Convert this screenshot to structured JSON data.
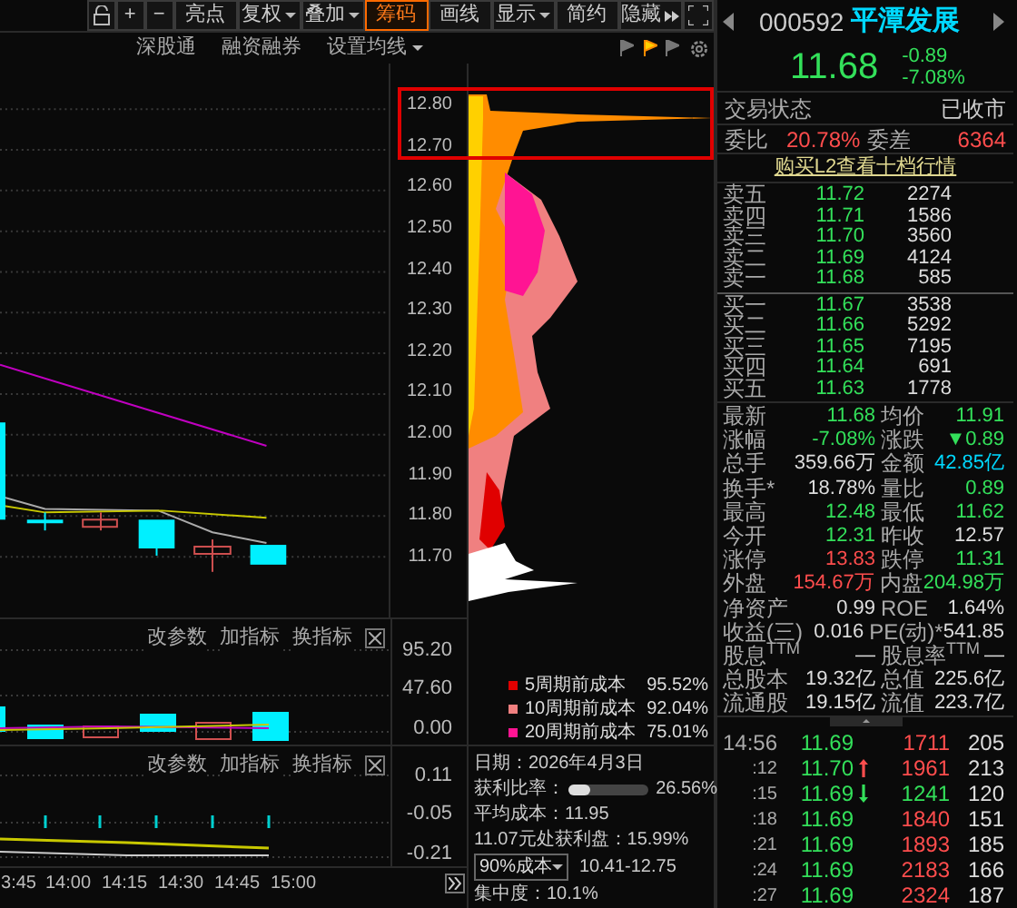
{
  "toolbar": {
    "buttons": [
      {
        "label": "+",
        "dropdown": false,
        "selected": false
      },
      {
        "label": "−",
        "dropdown": false,
        "selected": false
      },
      {
        "label": "亮点",
        "dropdown": false,
        "selected": false
      },
      {
        "label": "复权",
        "dropdown": true,
        "selected": false
      },
      {
        "label": "叠加",
        "dropdown": true,
        "selected": false
      },
      {
        "label": "筹码",
        "dropdown": false,
        "selected": true
      },
      {
        "label": "画线",
        "dropdown": false,
        "selected": false
      },
      {
        "label": "显示",
        "dropdown": true,
        "selected": false
      },
      {
        "label": "简约",
        "dropdown": false,
        "selected": false
      },
      {
        "label": "隐藏",
        "dropdown": false,
        "selected": false,
        "arrows": true
      }
    ]
  },
  "chart_toolbar": [
    {
      "label": "深股通",
      "dropdown": false
    },
    {
      "label": "融资融券",
      "dropdown": false
    },
    {
      "label": "设置均线",
      "dropdown": true
    }
  ],
  "main_chart": {
    "y_labels": [
      "12.80",
      "12.70",
      "12.60",
      "12.50",
      "12.40",
      "12.30",
      "12.20",
      "12.10",
      "12.00",
      "11.90",
      "11.80",
      "11.70"
    ]
  },
  "indicator_panes": [
    {
      "tools": [
        "改参数",
        "加指标",
        "换指标"
      ],
      "y_labels": [
        "95.20",
        "47.60",
        "0.00"
      ]
    },
    {
      "tools": [
        "改参数",
        "加指标",
        "换指标"
      ],
      "y_labels": [
        "0.11",
        "-0.05",
        "-0.21"
      ]
    }
  ],
  "time_axis": [
    "3:45",
    "14:00",
    "14:15",
    "14:30",
    "14:45",
    "15:00"
  ],
  "chip_panel": {
    "legend": [
      {
        "label": "5周期前成本",
        "value": "95.52%",
        "color": "#e00000"
      },
      {
        "label": "10周期前成本",
        "value": "92.04%",
        "color": "#f08080"
      },
      {
        "label": "20周期前成本",
        "value": "75.01%",
        "color": "#ff1493"
      }
    ],
    "date": "日期：2026年4月3日",
    "profit_label": "获利比率：",
    "profit_ratio": {
      "level": 0.2656,
      "reading": "26.56%"
    },
    "avg_cost": "平均成本：11.95",
    "profit_at": "11.07元处获利盘：15.99%",
    "cost_range": {
      "option": "90%成本",
      "value": "10.41-12.75"
    },
    "concentration": "集中度：10.1%"
  },
  "quote": {
    "code": "000592",
    "name": "平潭发展",
    "price": "11.68",
    "change": "-0.89",
    "percent": "-7.08%",
    "status_label": "交易状态",
    "status": "已收市",
    "ratio_label": "委比",
    "ratio": "20.78%",
    "diff_label": "委差",
    "diff": "6364",
    "l2_link": "购买L2查看十档行情",
    "asks": [
      {
        "label": "卖五",
        "price": "11.72",
        "volume": "2274"
      },
      {
        "label": "卖四",
        "price": "11.71",
        "volume": "1586"
      },
      {
        "label": "卖三",
        "price": "11.70",
        "volume": "3560"
      },
      {
        "label": "卖二",
        "price": "11.69",
        "volume": "4124"
      },
      {
        "label": "卖一",
        "price": "11.68",
        "volume": "585"
      }
    ],
    "bids": [
      {
        "label": "买一",
        "price": "11.67",
        "volume": "3538"
      },
      {
        "label": "买二",
        "price": "11.66",
        "volume": "5292"
      },
      {
        "label": "买三",
        "price": "11.65",
        "volume": "7195"
      },
      {
        "label": "买四",
        "price": "11.64",
        "volume": "691"
      },
      {
        "label": "买五",
        "price": "11.63",
        "volume": "1778"
      }
    ],
    "stats": [
      [
        {
          "label": "最新",
          "value": "11.68",
          "color": "#33e05a"
        },
        {
          "label": "均价",
          "value": "11.91",
          "color": "#33e05a"
        }
      ],
      [
        {
          "label": "涨幅",
          "value": "-7.08%",
          "color": "#33e05a"
        },
        {
          "label": "涨跌",
          "value": "▼0.89",
          "color": "#33e05a"
        }
      ],
      [
        {
          "label": "总手",
          "value": "359.66万",
          "color": "#dddddd"
        },
        {
          "label": "金额",
          "value": "42.85亿",
          "color": "#00d8ff"
        }
      ],
      [
        {
          "label": "换手*",
          "value": "18.78%",
          "color": "#dddddd"
        },
        {
          "label": "量比",
          "value": "0.89",
          "color": "#33e05a"
        }
      ],
      [
        {
          "label": "最高",
          "value": "12.48",
          "color": "#33e05a"
        },
        {
          "label": "最低",
          "value": "11.62",
          "color": "#33e05a"
        }
      ],
      [
        {
          "label": "今开",
          "value": "12.31",
          "color": "#33e05a"
        },
        {
          "label": "昨收",
          "value": "12.57",
          "color": "#dddddd"
        }
      ],
      [
        {
          "label": "涨停",
          "value": "13.83",
          "color": "#ff4d4d"
        },
        {
          "label": "跌停",
          "value": "11.31",
          "color": "#33e05a"
        }
      ],
      [
        {
          "label": "外盘",
          "value": "154.67万",
          "color": "#ff4d4d"
        },
        {
          "label": "内盘",
          "value": "204.98万",
          "color": "#33e05a"
        }
      ],
      [
        {
          "label": "净资产",
          "value": "0.99",
          "color": "#dddddd"
        },
        {
          "label": "ROE",
          "value": "1.64%",
          "color": "#dddddd"
        }
      ],
      [
        {
          "label": "收益(三)",
          "value": "0.016",
          "color": "#dddddd"
        },
        {
          "label": "PE(动)*",
          "value": "541.85",
          "color": "#dddddd"
        }
      ],
      [
        {
          "label": "股息$^{TTM}$",
          "value": "—",
          "color": "#dddddd"
        },
        {
          "label": "股息率$^{TTM}$",
          "value": "—",
          "color": "#dddddd"
        }
      ],
      [
        {
          "label": "总股本",
          "value": "19.32亿",
          "color": "#dddddd"
        },
        {
          "label": "总值",
          "value": "225.6亿",
          "color": "#dddddd"
        }
      ],
      [
        {
          "label": "流通股",
          "value": "19.15亿",
          "color": "#dddddd"
        },
        {
          "label": "流值",
          "value": "223.7亿",
          "color": "#dddddd"
        }
      ]
    ],
    "ticks": [
      {
        "time": "14:56",
        "price": "11.69",
        "up_arrow": false,
        "down_arrow": false,
        "volume": "1711",
        "color": "#ff4d4d",
        "count": "205"
      },
      {
        "time": ":12",
        "price": "11.70",
        "up_arrow": true,
        "down_arrow": false,
        "volume": "1961",
        "color": "#ff4d4d",
        "count": "213"
      },
      {
        "time": ":15",
        "price": "11.69",
        "up_arrow": false,
        "down_arrow": true,
        "volume": "1241",
        "color": "#33e05a",
        "count": "120"
      },
      {
        "time": ":18",
        "price": "11.69",
        "up_arrow": false,
        "down_arrow": false,
        "volume": "1840",
        "color": "#ff4d4d",
        "count": "151"
      },
      {
        "time": ":21",
        "price": "11.69",
        "up_arrow": false,
        "down_arrow": false,
        "volume": "1893",
        "color": "#ff4d4d",
        "count": "185"
      },
      {
        "time": ":24",
        "price": "11.69",
        "up_arrow": false,
        "down_arrow": false,
        "volume": "2183",
        "color": "#ff4d4d",
        "count": "166"
      },
      {
        "time": ":27",
        "price": "11.69",
        "up_arrow": false,
        "down_arrow": false,
        "volume": "2324",
        "color": "#ff4d4d",
        "count": "187"
      }
    ]
  }
}
